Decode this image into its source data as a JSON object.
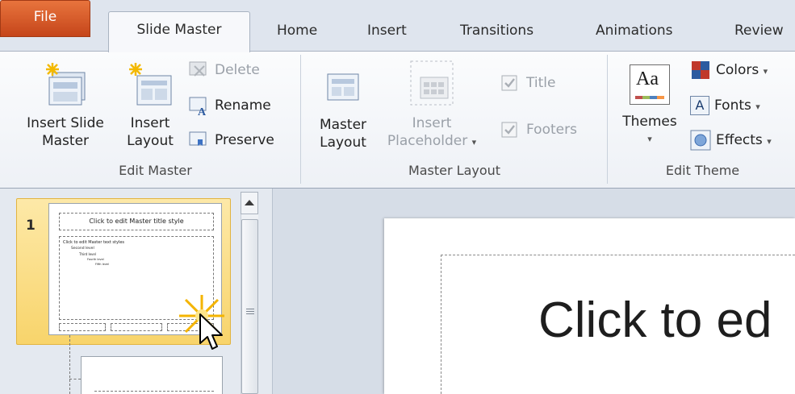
{
  "tabs": {
    "file": "File",
    "slide_master": "Slide Master",
    "home": "Home",
    "insert": "Insert",
    "transitions": "Transitions",
    "animations": "Animations",
    "review": "Review"
  },
  "edit_master": {
    "group_label": "Edit Master",
    "insert_slide_master_1": "Insert Slide",
    "insert_slide_master_2": "Master",
    "insert_layout_1": "Insert",
    "insert_layout_2": "Layout",
    "delete": "Delete",
    "rename": "Rename",
    "preserve": "Preserve"
  },
  "master_layout": {
    "group_label": "Master Layout",
    "master_layout_1": "Master",
    "master_layout_2": "Layout",
    "insert_placeholder_1": "Insert",
    "insert_placeholder_2": "Placeholder",
    "title_checkbox": "Title",
    "footers_checkbox": "Footers"
  },
  "edit_theme": {
    "group_label": "Edit Theme",
    "themes": "Themes",
    "themes_icon_text": "Aa",
    "colors": "Colors",
    "fonts": "Fonts",
    "fonts_icon_text": "A",
    "effects": "Effects"
  },
  "thumbnails": {
    "slide_number": "1",
    "master_title": "Click to edit Master title style",
    "master_text": "Click to edit Master text styles",
    "second_level": "Second level",
    "third_level": "Third level",
    "fourth_level": "Fourth level",
    "fifth_level": "Fifth level"
  },
  "slide": {
    "title_text": "Click to ed"
  },
  "colors": {
    "file_tab": "#d65a25",
    "selected_thumb": "#f8d46b",
    "ribbon_bg": "#f3f5f9"
  }
}
